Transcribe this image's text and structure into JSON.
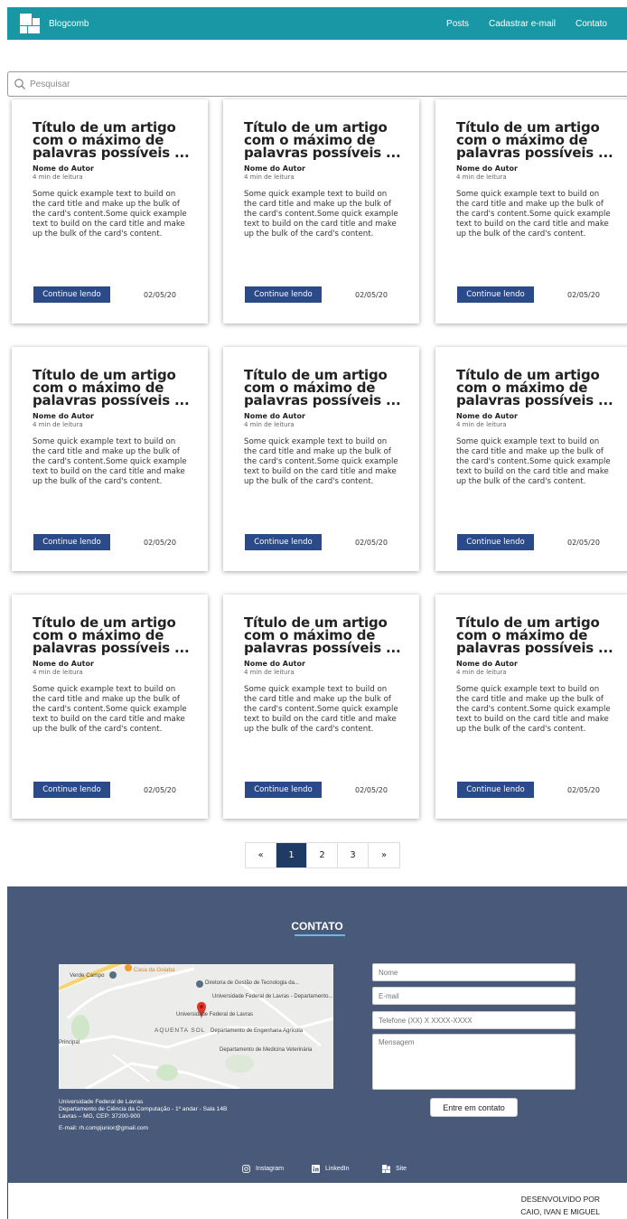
{
  "navbar": {
    "brand": "Blogcomb",
    "links": [
      "Posts",
      "Cadastrar e-mail",
      "Contato"
    ]
  },
  "search": {
    "placeholder": "Pesquisar"
  },
  "cards": [
    {
      "title": "Título de um artigo com o máximo de palavras possíveis ...",
      "author": "Nome do Autor",
      "read_time": "4 min de leitura",
      "text": "Some quick example text to build on the card title and make up the bulk of the card's content.Some quick example text to build on the card title and make up the bulk of the card's content.",
      "button": "Continue lendo",
      "date": "02/05/20"
    },
    {
      "title": "Título de um artigo com o máximo de palavras possíveis ...",
      "author": "Nome do Autor",
      "read_time": "4 min de leitura",
      "text": "Some quick example text to build on the card title and make up the bulk of the card's content.Some quick example text to build on the card title and make up the bulk of the card's content.",
      "button": "Continue lendo",
      "date": "02/05/20"
    },
    {
      "title": "Título de um artigo com o máximo de palavras possíveis ...",
      "author": "Nome do Autor",
      "read_time": "4 min de leitura",
      "text": "Some quick example text to build on the card title and make up the bulk of the card's content.Some quick example text to build on the card title and make up the bulk of the card's content.",
      "button": "Continue lendo",
      "date": "02/05/20"
    },
    {
      "title": "Título de um artigo com o máximo de palavras possíveis ...",
      "author": "Nome do Autor",
      "read_time": "4 min de leitura",
      "text": "Some quick example text to build on the card title and make up the bulk of the card's content.Some quick example text to build on the card title and make up the bulk of the card's content.",
      "button": "Continue lendo",
      "date": "02/05/20"
    },
    {
      "title": "Título de um artigo com o máximo de palavras possíveis ...",
      "author": "Nome do Autor",
      "read_time": "4 min de leitura",
      "text": "Some quick example text to build on the card title and make up the bulk of the card's content.Some quick example text to build on the card title and make up the bulk of the card's content.",
      "button": "Continue lendo",
      "date": "02/05/20"
    },
    {
      "title": "Título de um artigo com o máximo de palavras possíveis ...",
      "author": "Nome do Autor",
      "read_time": "4 min de leitura",
      "text": "Some quick example text to build on the card title and make up the bulk of the card's content.Some quick example text to build on the card title and make up the bulk of the card's content.",
      "button": "Continue lendo",
      "date": "02/05/20"
    },
    {
      "title": "Título de um artigo com o máximo de palavras possíveis ...",
      "author": "Nome do Autor",
      "read_time": "4 min de leitura",
      "text": "Some quick example text to build on the card title and make up the bulk of the card's content.Some quick example text to build on the card title and make up the bulk of the card's content.",
      "button": "Continue lendo",
      "date": "02/05/20"
    },
    {
      "title": "Título de um artigo com o máximo de palavras possíveis ...",
      "author": "Nome do Autor",
      "read_time": "4 min de leitura",
      "text": "Some quick example text to build on the card title and make up the bulk of the card's content.Some quick example text to build on the card title and make up the bulk of the card's content.",
      "button": "Continue lendo",
      "date": "02/05/20"
    },
    {
      "title": "Título de um artigo com o máximo de palavras possíveis ...",
      "author": "Nome do Autor",
      "read_time": "4 min de leitura",
      "text": "Some quick example text to build on the card title and make up the bulk of the card's content.Some quick example text to build on the card title and make up the bulk of the card's content.",
      "button": "Continue lendo",
      "date": "02/05/20"
    }
  ],
  "pagination": {
    "prev": "«",
    "pages": [
      "1",
      "2",
      "3"
    ],
    "next": "»",
    "active": "1"
  },
  "contact": {
    "title": "CONTATO",
    "map": {
      "places": [
        "Casa da Goiaba",
        "Verde Campo",
        "Diretoria de Gestão de Tecnologia da...",
        "Universidade Federal de Lavras - Departamento...",
        "Universidade Federal de Lavras",
        "AQUENTA SOL",
        "Departamento de Engenharia Agrícola",
        "Departamento de Medicina Veterinária",
        "Principal"
      ]
    },
    "address": {
      "line1": "Universidade Federal de Lavras",
      "line2": "Departamento de Ciência da Computação - 1º andar - Sala 14B",
      "line3": "Lavras – MG, CEP: 37200-900",
      "email": "E-mail: rh.compjunior@gmail.com"
    },
    "form": {
      "name_placeholder": "Nome",
      "email_placeholder": "E-mail",
      "phone_placeholder": "Telefone (XX) X XXXX-XXXX",
      "message_placeholder": "Mensagem",
      "submit": "Entre em contato"
    },
    "social": [
      {
        "label": "Instagram",
        "icon": "instagram-icon"
      },
      {
        "label": "LinkedIn",
        "icon": "linkedin-icon"
      },
      {
        "label": "Site",
        "icon": "site-icon"
      }
    ]
  },
  "credits": {
    "line1": "DESENVOLVIDO POR",
    "line2": "CAIO, IVAN E MIGUEL"
  },
  "colors": {
    "navbar": "#1a97a4",
    "footer": "#48597a",
    "button": "#2b4a8a",
    "active_page": "#1f3a63"
  }
}
